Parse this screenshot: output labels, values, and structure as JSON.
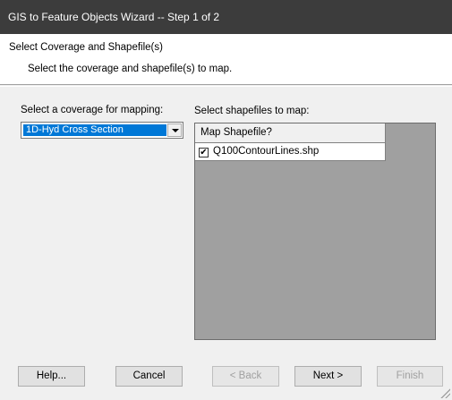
{
  "window": {
    "title": "GIS to Feature Objects Wizard -- Step 1 of 2"
  },
  "header": {
    "heading": "Select Coverage and Shapefile(s)",
    "subheading": "Select the coverage and shapefile(s) to map."
  },
  "coverage": {
    "label": "Select a coverage for mapping:",
    "selected": "1D-Hyd Cross Section"
  },
  "shapefiles": {
    "label": "Select shapefiles to map:",
    "column_header": "Map Shapefile?",
    "rows": [
      {
        "name": "Q100ContourLines.shp",
        "checked": true
      }
    ]
  },
  "buttons": {
    "help": "Help...",
    "cancel": "Cancel",
    "back": "< Back",
    "next": "Next >",
    "finish": "Finish"
  }
}
